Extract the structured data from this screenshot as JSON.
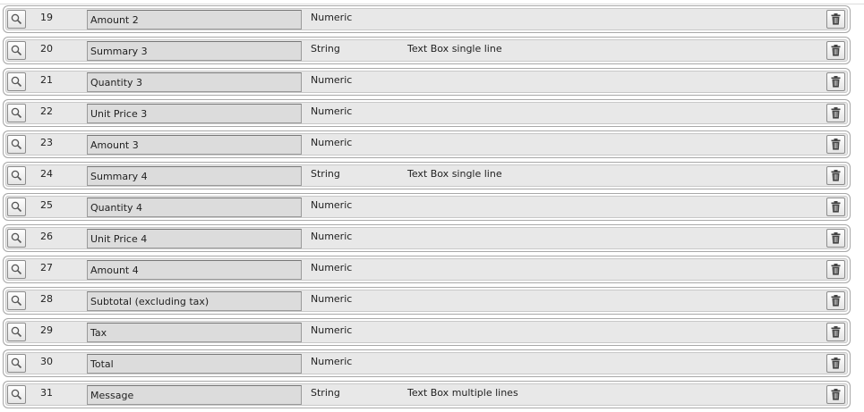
{
  "icons": {
    "inspect": "magnifier-icon",
    "delete": "trash-icon"
  },
  "colors": {
    "row_background": "#e8e8e8",
    "row_border": "#a8a8a8",
    "input_background": "#dcdcdc",
    "text": "#222222"
  },
  "rows": [
    {
      "number": "19",
      "name": "Amount 2",
      "type": "Numeric",
      "control": ""
    },
    {
      "number": "20",
      "name": "Summary 3",
      "type": "String",
      "control": "Text Box single line"
    },
    {
      "number": "21",
      "name": "Quantity 3",
      "type": "Numeric",
      "control": ""
    },
    {
      "number": "22",
      "name": "Unit Price 3",
      "type": "Numeric",
      "control": ""
    },
    {
      "number": "23",
      "name": "Amount 3",
      "type": "Numeric",
      "control": ""
    },
    {
      "number": "24",
      "name": "Summary 4",
      "type": "String",
      "control": "Text Box single line"
    },
    {
      "number": "25",
      "name": "Quantity 4",
      "type": "Numeric",
      "control": ""
    },
    {
      "number": "26",
      "name": "Unit Price 4",
      "type": "Numeric",
      "control": ""
    },
    {
      "number": "27",
      "name": "Amount 4",
      "type": "Numeric",
      "control": ""
    },
    {
      "number": "28",
      "name": "Subtotal (excluding tax)",
      "type": "Numeric",
      "control": ""
    },
    {
      "number": "29",
      "name": "Tax",
      "type": "Numeric",
      "control": ""
    },
    {
      "number": "30",
      "name": "Total",
      "type": "Numeric",
      "control": ""
    },
    {
      "number": "31",
      "name": "Message",
      "type": "String",
      "control": "Text Box multiple lines"
    }
  ]
}
